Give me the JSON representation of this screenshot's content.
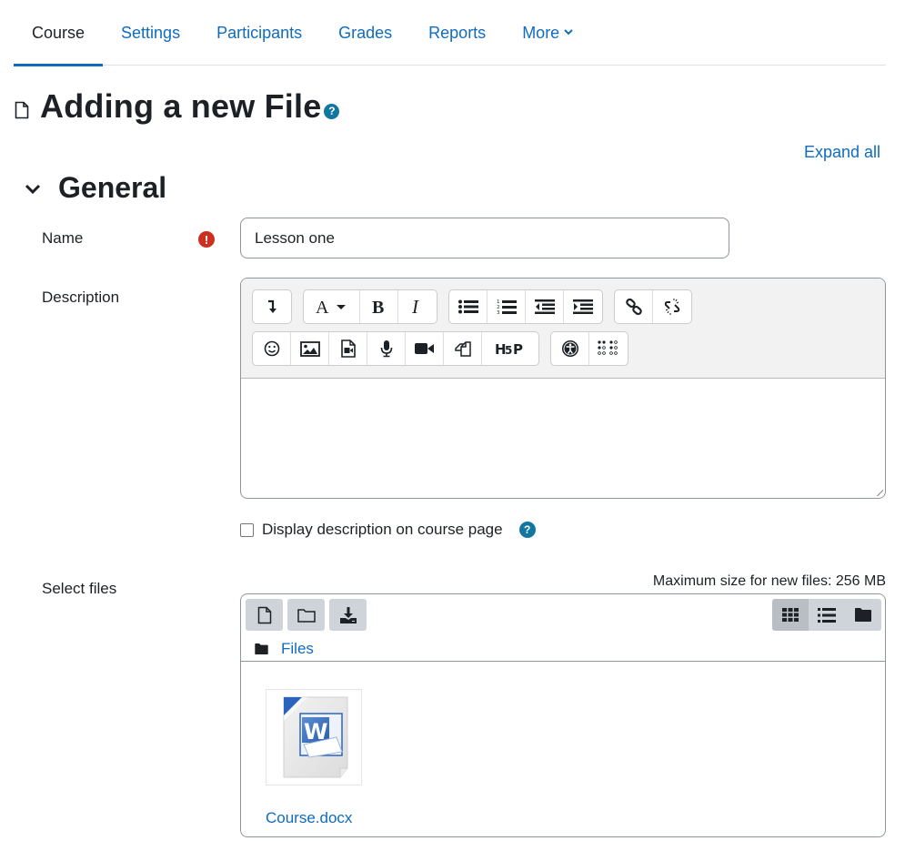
{
  "nav": {
    "tabs": [
      {
        "label": "Course",
        "active": true
      },
      {
        "label": "Settings"
      },
      {
        "label": "Participants"
      },
      {
        "label": "Grades"
      },
      {
        "label": "Reports"
      },
      {
        "label": "More"
      }
    ]
  },
  "page": {
    "title": "Adding a new File",
    "title_icon": "file-icon",
    "help_icon": "question-circle-icon",
    "expand_all": "Expand all"
  },
  "section": {
    "title": "General",
    "toggle_icon": "chevron-down-icon"
  },
  "form": {
    "name": {
      "label": "Name",
      "value": "Lesson one",
      "required_icon": "exclamation-circle-icon"
    },
    "description": {
      "label": "Description",
      "value": "",
      "toolbar_row1": [
        [
          "collapse-toolbar"
        ],
        [
          "font-style",
          "bold",
          "italic"
        ],
        [
          "unordered-list",
          "ordered-list",
          "outdent",
          "indent"
        ],
        [
          "link",
          "unlink"
        ]
      ],
      "toolbar_row2": [
        [
          "emoticon",
          "image",
          "media",
          "record-audio",
          "record-video",
          "manage-files",
          "h5p"
        ],
        [
          "accessibility-checker",
          "screenreader-helper"
        ]
      ]
    },
    "display_description": {
      "label": "Display description on course page",
      "checked": false
    },
    "select_files": {
      "label": "Select files",
      "max_size": "Maximum size for new files: 256 MB",
      "path": "Files",
      "files": [
        {
          "name": "Course.docx",
          "type": "word-document"
        }
      ],
      "view_mode": "icons"
    }
  },
  "colors": {
    "link": "#0f6cbf",
    "required": "#ca3120",
    "help": "#1177a0",
    "text": "#1d2125"
  }
}
